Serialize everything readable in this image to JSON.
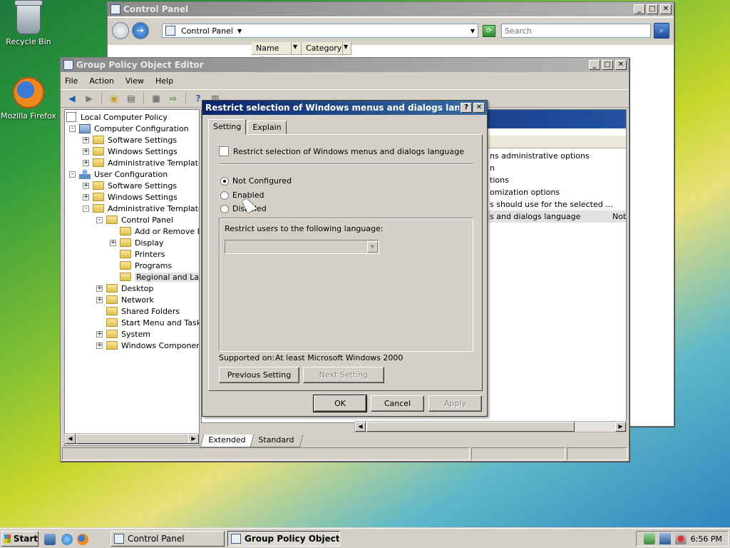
{
  "desktop": {
    "icons": [
      {
        "label": "Recycle Bin"
      },
      {
        "label": "Mozilla Firefox"
      }
    ]
  },
  "control_panel": {
    "title": "Control Panel",
    "address": "Control Panel",
    "search_placeholder": "Search",
    "columns": [
      "Name",
      "Category"
    ]
  },
  "gpedit": {
    "title": "Group Policy Object Editor",
    "menu": [
      "File",
      "Action",
      "View",
      "Help"
    ],
    "tree": [
      {
        "label": "Local Computer Policy",
        "level": 0,
        "expander": "",
        "icon": "policy"
      },
      {
        "label": "Computer Configuration",
        "level": 1,
        "expander": "-",
        "icon": "pc"
      },
      {
        "label": "Software Settings",
        "level": 2,
        "expander": "+",
        "icon": "folder"
      },
      {
        "label": "Windows Settings",
        "level": 2,
        "expander": "+",
        "icon": "folder"
      },
      {
        "label": "Administrative Templates",
        "level": 2,
        "expander": "+",
        "icon": "folder"
      },
      {
        "label": "User Configuration",
        "level": 1,
        "expander": "-",
        "icon": "user"
      },
      {
        "label": "Software Settings",
        "level": 2,
        "expander": "+",
        "icon": "folder"
      },
      {
        "label": "Windows Settings",
        "level": 2,
        "expander": "+",
        "icon": "folder"
      },
      {
        "label": "Administrative Templates",
        "level": 2,
        "expander": "-",
        "icon": "folder"
      },
      {
        "label": "Control Panel",
        "level": 3,
        "expander": "-",
        "icon": "folder"
      },
      {
        "label": "Add or Remove Pro",
        "level": 4,
        "expander": "",
        "icon": "folder"
      },
      {
        "label": "Display",
        "level": 4,
        "expander": "+",
        "icon": "folder"
      },
      {
        "label": "Printers",
        "level": 4,
        "expander": "",
        "icon": "folder"
      },
      {
        "label": "Programs",
        "level": 4,
        "expander": "",
        "icon": "folder"
      },
      {
        "label": "Regional and Langu",
        "level": 4,
        "expander": "",
        "icon": "folder",
        "selected": true
      },
      {
        "label": "Desktop",
        "level": 3,
        "expander": "+",
        "icon": "folder"
      },
      {
        "label": "Network",
        "level": 3,
        "expander": "+",
        "icon": "folder"
      },
      {
        "label": "Shared Folders",
        "level": 3,
        "expander": "",
        "icon": "folder"
      },
      {
        "label": "Start Menu and Taskba",
        "level": 3,
        "expander": "",
        "icon": "folder"
      },
      {
        "label": "System",
        "level": 3,
        "expander": "+",
        "icon": "folder"
      },
      {
        "label": "Windows Components",
        "level": 3,
        "expander": "+",
        "icon": "folder"
      }
    ],
    "settings_rows": [
      {
        "text": "ns administrative options",
        "state": ""
      },
      {
        "text": "n",
        "state": ""
      },
      {
        "text": "tions",
        "state": ""
      },
      {
        "text": "omization options",
        "state": ""
      },
      {
        "text": "s should use for the selected ...",
        "state": ""
      },
      {
        "text": "s and dialogs language",
        "state": "Not",
        "selected": true
      }
    ],
    "bottom_tabs": [
      "Extended",
      "Standard"
    ]
  },
  "dialog": {
    "title": "Restrict selection of Windows menus and dialogs language Pro...",
    "help_label": "?",
    "close_label": "✕",
    "tabs": [
      "Setting",
      "Explain"
    ],
    "policy_name": "Restrict selection of Windows menus and dialogs language",
    "radios": [
      {
        "label": "Not Configured",
        "checked": true
      },
      {
        "label": "Enabled",
        "checked": false
      },
      {
        "label": "Disabled",
        "checked": false
      }
    ],
    "option_label": "Restrict users to the following language:",
    "supported_label": "Supported on:",
    "supported_value": "At least Microsoft Windows 2000",
    "prev_button": "Previous Setting",
    "next_button": "Next Setting",
    "ok_button": "OK",
    "cancel_button": "Cancel",
    "apply_button": "Apply"
  },
  "taskbar": {
    "start_label": "Start",
    "tasks": [
      {
        "label": "Control Panel"
      },
      {
        "label": "Group Policy Object E..."
      }
    ],
    "clock": "6:56 PM"
  },
  "colors": {
    "active_title": "#0a246a",
    "window_face": "#d4d0c8"
  }
}
